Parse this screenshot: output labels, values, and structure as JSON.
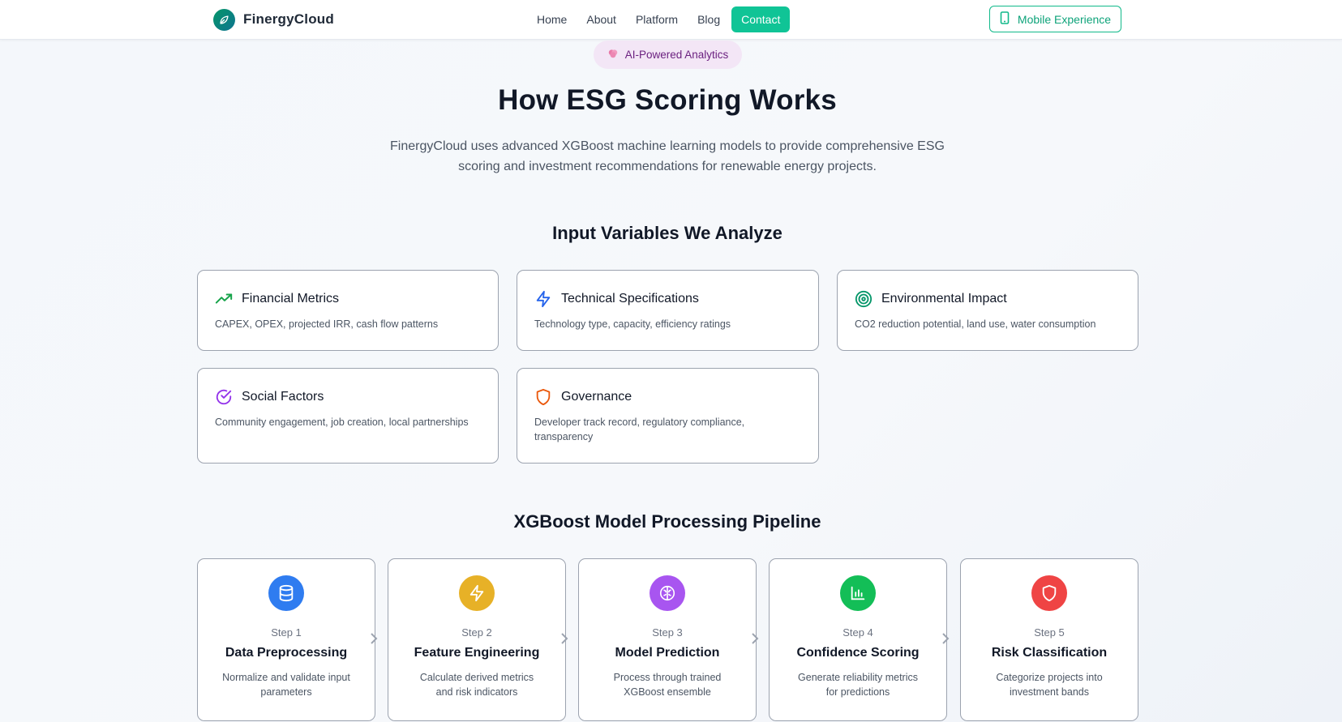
{
  "nav": {
    "brand": "FinergyCloud",
    "links": [
      {
        "label": "Home"
      },
      {
        "label": "About"
      },
      {
        "label": "Platform"
      },
      {
        "label": "Blog"
      },
      {
        "label": "Contact"
      }
    ],
    "mobile_button": "Mobile Experience"
  },
  "hero": {
    "badge": "AI-Powered Analytics",
    "title": "How ESG Scoring Works",
    "subtitle": "FinergyCloud uses advanced XGBoost machine learning models to provide comprehensive ESG scoring and investment recommendations for renewable energy projects."
  },
  "inputs": {
    "title": "Input Variables We Analyze",
    "cards": [
      {
        "title": "Financial Metrics",
        "desc": "CAPEX, OPEX, projected IRR, cash flow patterns",
        "icon": "trending-up-icon",
        "color": "#16a34a"
      },
      {
        "title": "Technical Specifications",
        "desc": "Technology type, capacity, efficiency ratings",
        "icon": "lightning-icon",
        "color": "#2563eb"
      },
      {
        "title": "Environmental Impact",
        "desc": "CO2 reduction potential, land use, water consumption",
        "icon": "target-icon",
        "color": "#059669"
      },
      {
        "title": "Social Factors",
        "desc": "Community engagement, job creation, local partnerships",
        "icon": "check-circle-icon",
        "color": "#9333ea"
      },
      {
        "title": "Governance",
        "desc": "Developer track record, regulatory compliance, transparency",
        "icon": "shield-icon",
        "color": "#ea580c"
      }
    ]
  },
  "pipeline": {
    "title": "XGBoost Model Processing Pipeline",
    "steps": [
      {
        "step": "Step 1",
        "title": "Data Preprocessing",
        "desc": "Normalize and validate input parameters",
        "icon": "database-icon",
        "color": "#2f7cf0"
      },
      {
        "step": "Step 2",
        "title": "Feature Engineering",
        "desc": "Calculate derived metrics and risk indicators",
        "icon": "lightning-icon",
        "color": "#e7b127"
      },
      {
        "step": "Step 3",
        "title": "Model Prediction",
        "desc": "Process through trained XGBoost ensemble",
        "icon": "brain-icon",
        "color": "#a855f0"
      },
      {
        "step": "Step 4",
        "title": "Confidence Scoring",
        "desc": "Generate reliability metrics for predictions",
        "icon": "bar-chart-icon",
        "color": "#13be57"
      },
      {
        "step": "Step 5",
        "title": "Risk Classification",
        "desc": "Categorize projects into investment bands",
        "icon": "shield-icon",
        "color": "#ef4444"
      }
    ]
  }
}
